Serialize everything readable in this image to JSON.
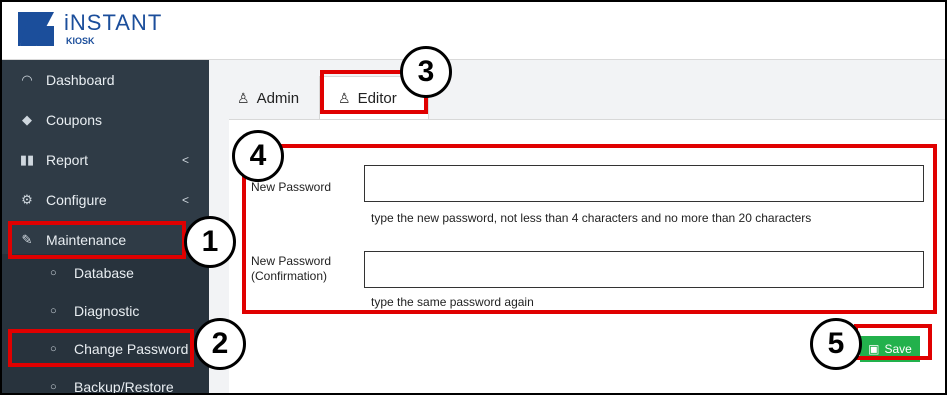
{
  "app": {
    "logo_name": "iNSTANT",
    "logo_sub": "KIOSK",
    "brand_color": "#1b4e9b"
  },
  "sidebar": {
    "items": [
      {
        "label": "Dashboard",
        "icon": "dashboard-gauge-icon"
      },
      {
        "label": "Coupons",
        "icon": "tag-icon"
      },
      {
        "label": "Report",
        "icon": "bar-chart-icon",
        "chevron": "<"
      },
      {
        "label": "Configure",
        "icon": "gear-icon",
        "chevron": "<"
      },
      {
        "label": "Maintenance",
        "icon": "wrench-icon"
      }
    ],
    "subitems": [
      {
        "label": "Database"
      },
      {
        "label": "Diagnostic"
      },
      {
        "label": "Change Password"
      },
      {
        "label": "Backup/Restore"
      }
    ]
  },
  "tabs": [
    {
      "label": "Admin",
      "icon": "user-icon"
    },
    {
      "label": "Editor",
      "icon": "user-icon",
      "active": true
    }
  ],
  "form": {
    "new_password": {
      "label": "New Password",
      "value": "",
      "help": "type the new password, not less than 4 characters and no more than 20 characters"
    },
    "confirm_password": {
      "label_line1": "New Password",
      "label_line2": "(Confirmation)",
      "value": "",
      "help": "type the same password again"
    },
    "save_label": "Save",
    "save_color": "#22b14c"
  },
  "callouts": [
    "1",
    "2",
    "3",
    "4",
    "5"
  ],
  "annotation_color": "#e00000"
}
